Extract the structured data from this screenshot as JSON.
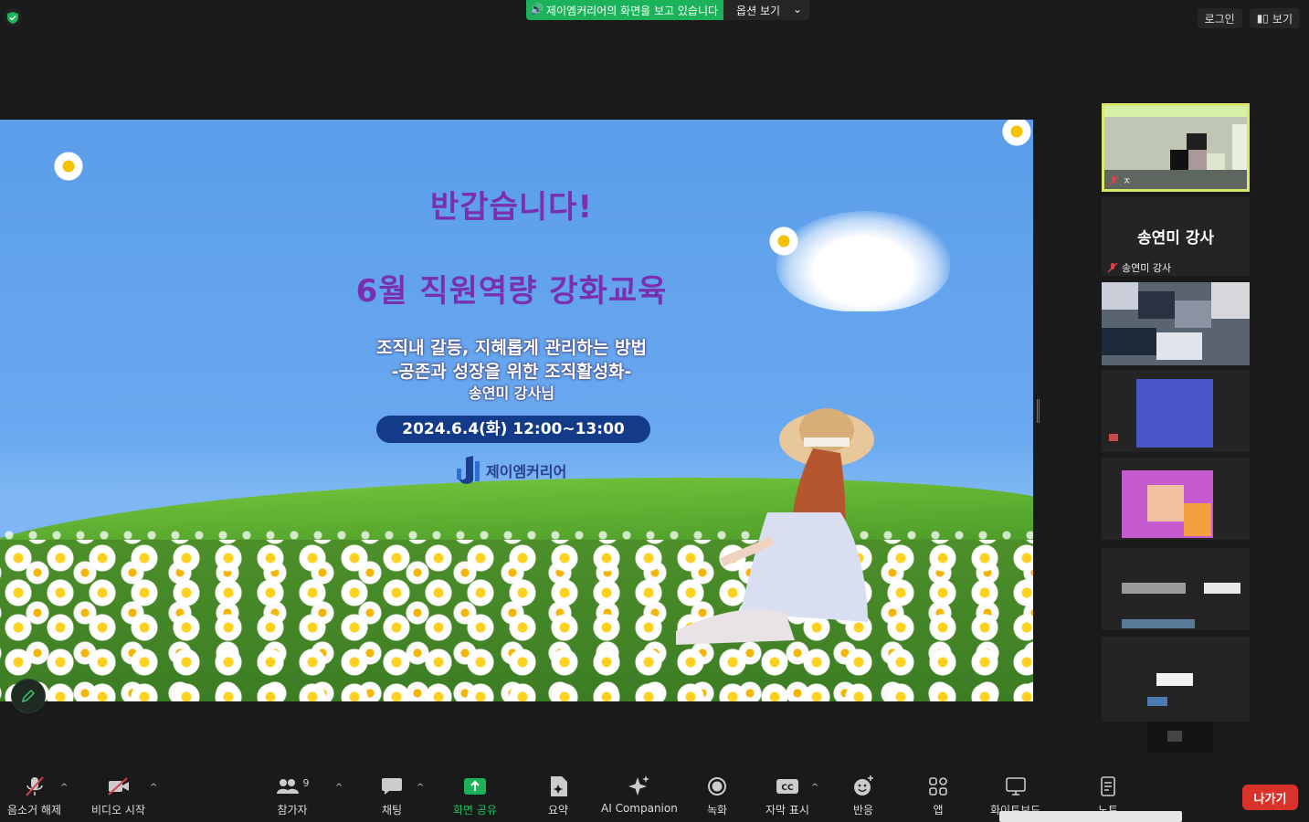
{
  "top": {
    "share_banner": "제이엠커리어의 화면을 보고 있습니다",
    "view_options": "옵션 보기",
    "login": "로그인",
    "view": "보기"
  },
  "slide": {
    "greeting": "반갑습니다!",
    "title": "6월 직원역량 강화교육",
    "line1": "조직내 갈등, 지혜롭게 관리하는 방법",
    "line2": "-공존과 성장을 위한 조직활성화-",
    "instructor": "송연미 강사님",
    "date": "2024.6.4(화) 12:00~13:00",
    "logo_text": "제이엠커리어"
  },
  "participants": {
    "self_initial": "ㅈ",
    "speaker_name": "송연미 강사",
    "speaker_label": "송연미 강사"
  },
  "toolbar": {
    "mute": "음소거 해제",
    "video": "비디오 시작",
    "participants": "참가자",
    "participants_count": "9",
    "chat": "채팅",
    "share": "화면 공유",
    "summary": "요약",
    "ai": "AI Companion",
    "record": "녹화",
    "captions": "자막 표시",
    "reactions": "반응",
    "apps": "앱",
    "whiteboard": "화이트보드",
    "notes": "노트",
    "leave": "나가기"
  },
  "colors": {
    "share_green": "#1cb25a",
    "leave_red": "#d9322a",
    "title_purple": "#7a2fb0",
    "date_pill": "#143a8a"
  }
}
